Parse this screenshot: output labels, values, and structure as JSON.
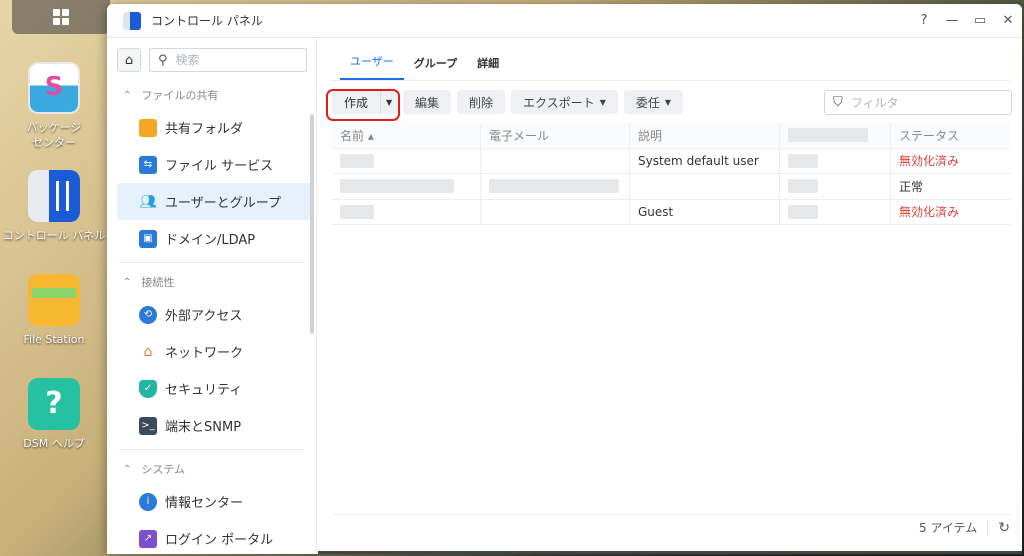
{
  "desktop": {
    "icons": [
      {
        "label": "パッケージ\nセンター"
      },
      {
        "label": "コントロール パネル"
      },
      {
        "label": "File Station"
      },
      {
        "label": "DSM ヘルプ"
      }
    ]
  },
  "window": {
    "title": "コントロール パネル",
    "controls": {
      "help": "?",
      "minimize": "—",
      "maximize": "▭",
      "close": "✕"
    }
  },
  "sidebar": {
    "search_placeholder": "検索",
    "sections": [
      {
        "label": "ファイルの共有",
        "items": [
          {
            "label": "共有フォルダ",
            "icon": "folder-icon"
          },
          {
            "label": "ファイル サービス",
            "icon": "file-service-icon"
          },
          {
            "label": "ユーザーとグループ",
            "icon": "users-icon",
            "active": true
          },
          {
            "label": "ドメイン/LDAP",
            "icon": "domain-icon"
          }
        ]
      },
      {
        "label": "接続性",
        "items": [
          {
            "label": "外部アクセス",
            "icon": "external-access-icon"
          },
          {
            "label": "ネットワーク",
            "icon": "network-icon"
          },
          {
            "label": "セキュリティ",
            "icon": "shield-icon"
          },
          {
            "label": "端末とSNMP",
            "icon": "terminal-icon"
          }
        ]
      },
      {
        "label": "システム",
        "items": [
          {
            "label": "情報センター",
            "icon": "info-icon"
          },
          {
            "label": "ログイン ポータル",
            "icon": "login-portal-icon"
          }
        ]
      }
    ]
  },
  "main": {
    "tabs": [
      {
        "label": "ユーザー",
        "active": true
      },
      {
        "label": "グループ"
      },
      {
        "label": "詳細"
      }
    ],
    "toolbar": {
      "create": "作成",
      "edit": "編集",
      "delete": "削除",
      "export": "エクスポート",
      "delegate": "委任",
      "filter_placeholder": "フィルタ"
    },
    "table": {
      "columns": [
        "名前 ▴",
        "電子メール",
        "説明",
        "",
        "ステータス"
      ],
      "rows": [
        {
          "description": "System default user",
          "status": "無効化済み",
          "status_color": "#e0453c"
        },
        {
          "description": "",
          "status": "正常",
          "status_color": "#333333"
        },
        {
          "description": "Guest",
          "status": "無効化済み",
          "status_color": "#e0453c"
        }
      ]
    },
    "footer": {
      "count": "5 アイテム",
      "refresh_icon": "refresh-icon"
    }
  }
}
